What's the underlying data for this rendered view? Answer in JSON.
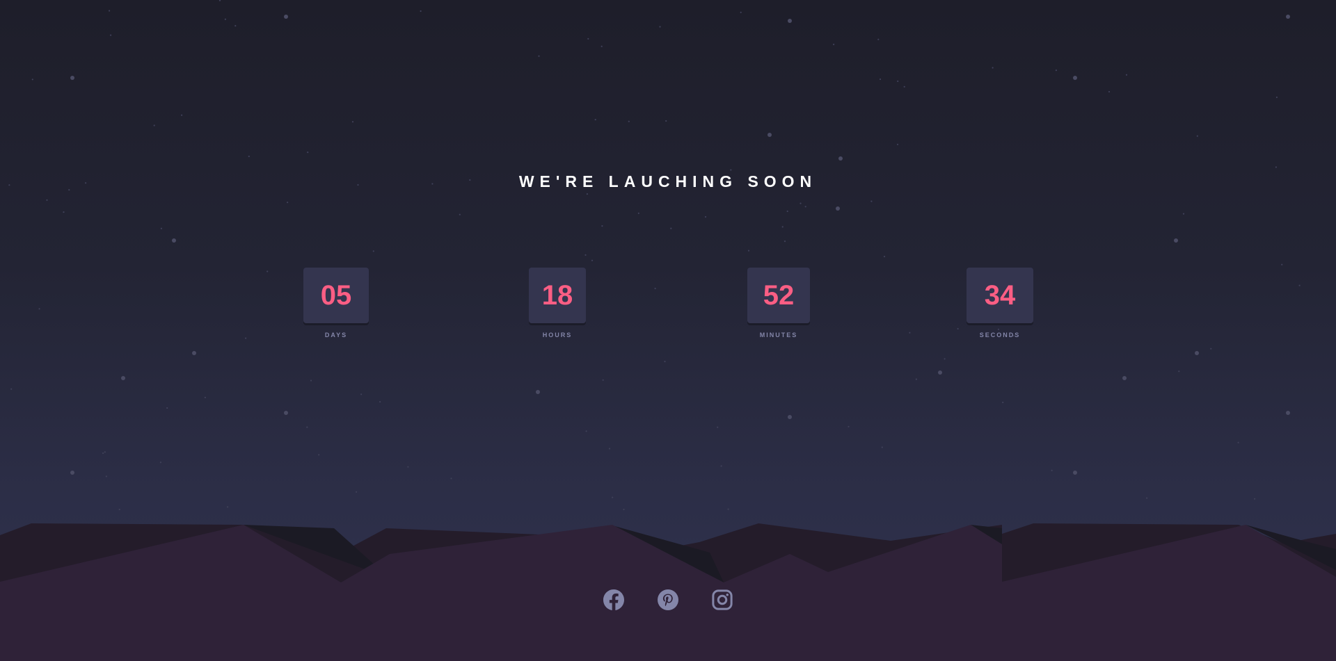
{
  "title": "WE'RE LAUCHING SOON",
  "countdown": [
    {
      "value": "05",
      "label": "DAYS"
    },
    {
      "value": "18",
      "label": "HOURS"
    },
    {
      "value": "52",
      "label": "MINUTES"
    },
    {
      "value": "34",
      "label": "SECONDS"
    }
  ],
  "socials": [
    {
      "icon": "facebook-icon"
    },
    {
      "icon": "pinterest-icon"
    },
    {
      "icon": "instagram-icon"
    }
  ],
  "colors": {
    "accent": "#fb5e84",
    "card": "#34354f",
    "label": "#8486a9",
    "icon": "#8486a9",
    "hill": "#2f2238"
  }
}
